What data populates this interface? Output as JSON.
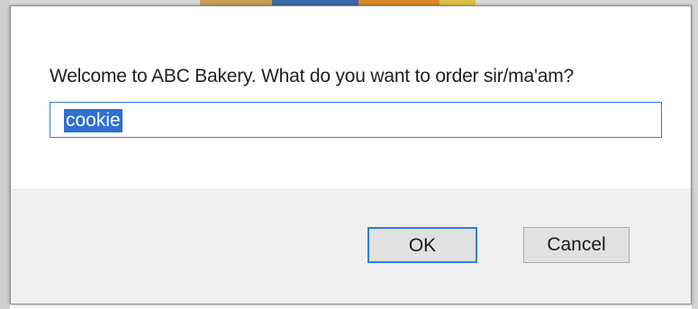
{
  "dialog": {
    "message": "Welcome to ABC Bakery. What do you want to order sir/ma'am?",
    "input_value": "cookie",
    "ok_label": "OK",
    "cancel_label": "Cancel"
  },
  "colors": {
    "accent": "#2f7fd6",
    "selection": "#2f6fd0",
    "footer_bg": "#f0f0f0",
    "button_bg": "#e1e1e1"
  }
}
